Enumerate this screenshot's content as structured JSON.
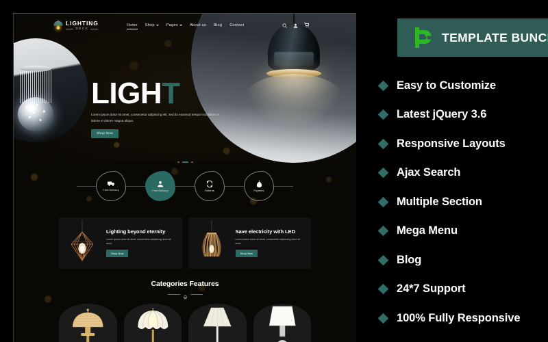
{
  "preview": {
    "brand": {
      "name": "LIGHTING",
      "sub": "DECK",
      "icon": "pendant-lamp-icon"
    },
    "nav": [
      {
        "label": "Home",
        "caret": false,
        "active": true
      },
      {
        "label": "Shop",
        "caret": true,
        "active": false
      },
      {
        "label": "Pages",
        "caret": true,
        "active": false
      },
      {
        "label": "About us",
        "caret": false,
        "active": false
      },
      {
        "label": "Blog",
        "caret": false,
        "active": false
      },
      {
        "label": "Contact",
        "caret": false,
        "active": false
      }
    ],
    "nav_icons": [
      "search-icon",
      "user-icon",
      "cart-icon"
    ],
    "hero": {
      "title_part1": "LIGH",
      "title_part2": "T",
      "paragraph": "Lorem ipsum dolor sit amet, consectetur adipiscing elit, sed do eiusmod tempor incididunt ut labore et dolore magna aliqua.",
      "button": "Shop Now",
      "slider_dots": 3,
      "active_dot": 2
    },
    "feature_badges": [
      {
        "label": "Free Delivery",
        "icon": "truck-icon",
        "active": false
      },
      {
        "label": "Free Delivery",
        "icon": "support-icon",
        "active": true
      },
      {
        "label": "Returns",
        "icon": "refresh-icon",
        "active": false
      },
      {
        "label": "Payment",
        "icon": "money-bag-icon",
        "active": false
      }
    ],
    "promos": [
      {
        "title": "Lighting beyond eternity",
        "desc": "Lorem ipsum dolor sit amet, consectetur adipiscing dolor sit amet.",
        "button": "Shop Now",
        "lamp": "geometric-cage-lamp"
      },
      {
        "title": "Save electricity with LED",
        "desc": "Lorem ipsum dolor sit amet, consectetur adipiscing dolor sit amet.",
        "button": "Shop Now",
        "lamp": "wooden-slat-lamp"
      }
    ],
    "categories": {
      "heading": "Categories Features",
      "divider_icon": "lamp-divider-icon",
      "cards": [
        "rattan-dome-lamp",
        "petal-glass-lamp",
        "tapered-shade-lamp",
        "drum-shade-lamp"
      ]
    }
  },
  "banner": {
    "title": "TEMPLATE BUNCH",
    "logo": "template-bunch-logo",
    "bg_color": "#2f5d55",
    "logo_color": "#2db723"
  },
  "features": [
    "Easy to Customize",
    "Latest jQuery 3.6",
    "Responsive Layouts",
    "Ajax Search",
    "Multiple Section",
    "Mega Menu",
    "Blog",
    "24*7 Support",
    "100% Fully Responsive"
  ],
  "colors": {
    "teal": "#2a6a63",
    "banner_teal": "#2f5d55",
    "green": "#2db723",
    "bullet": "#2e6e66"
  }
}
